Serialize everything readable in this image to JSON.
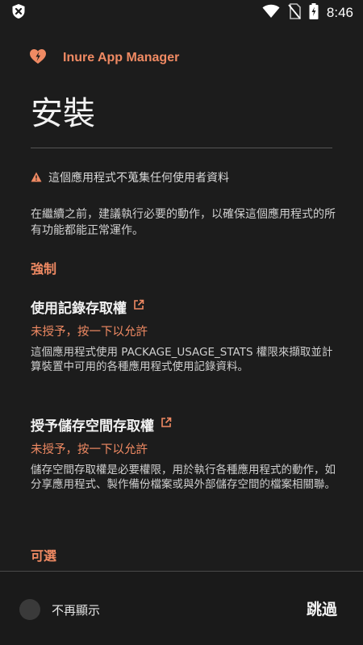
{
  "status_bar": {
    "time": "8:46",
    "icons": [
      "shield-x-icon",
      "wifi-icon",
      "no-sim-icon",
      "battery-charging-icon"
    ]
  },
  "header": {
    "logo_icon": "heart-bolt-icon",
    "app_name": "Inure App Manager"
  },
  "page": {
    "title": "安裝",
    "warning_icon": "warning-icon",
    "warning_text": "這個應用程式不蒐集任何使用者資料",
    "intro": "在繼續之前，建議執行必要的動作，以確保這個應用程式的所有功能都能正常運作。"
  },
  "sections": {
    "required_heading": "強制",
    "optional_heading": "可選"
  },
  "permissions": [
    {
      "title": "使用記錄存取權",
      "status": "未授予，按一下以允許",
      "description": "這個應用程式使用 PACKAGE_USAGE_STATS 權限來擷取並計算裝置中可用的各種應用程式使用記錄資料。"
    },
    {
      "title": "授予儲存空間存取權",
      "status": "未授予，按一下以允許",
      "description": "儲存空間存取權是必要權限，用於執行各種應用程式的動作，如分享應用程式、製作備份檔案或與外部儲存空間的檔案相關聯。"
    }
  ],
  "footer": {
    "dont_show_again": "不再顯示",
    "skip_label": "跳過"
  },
  "colors": {
    "accent": "#f08a63",
    "background": "#1c1c1c"
  }
}
